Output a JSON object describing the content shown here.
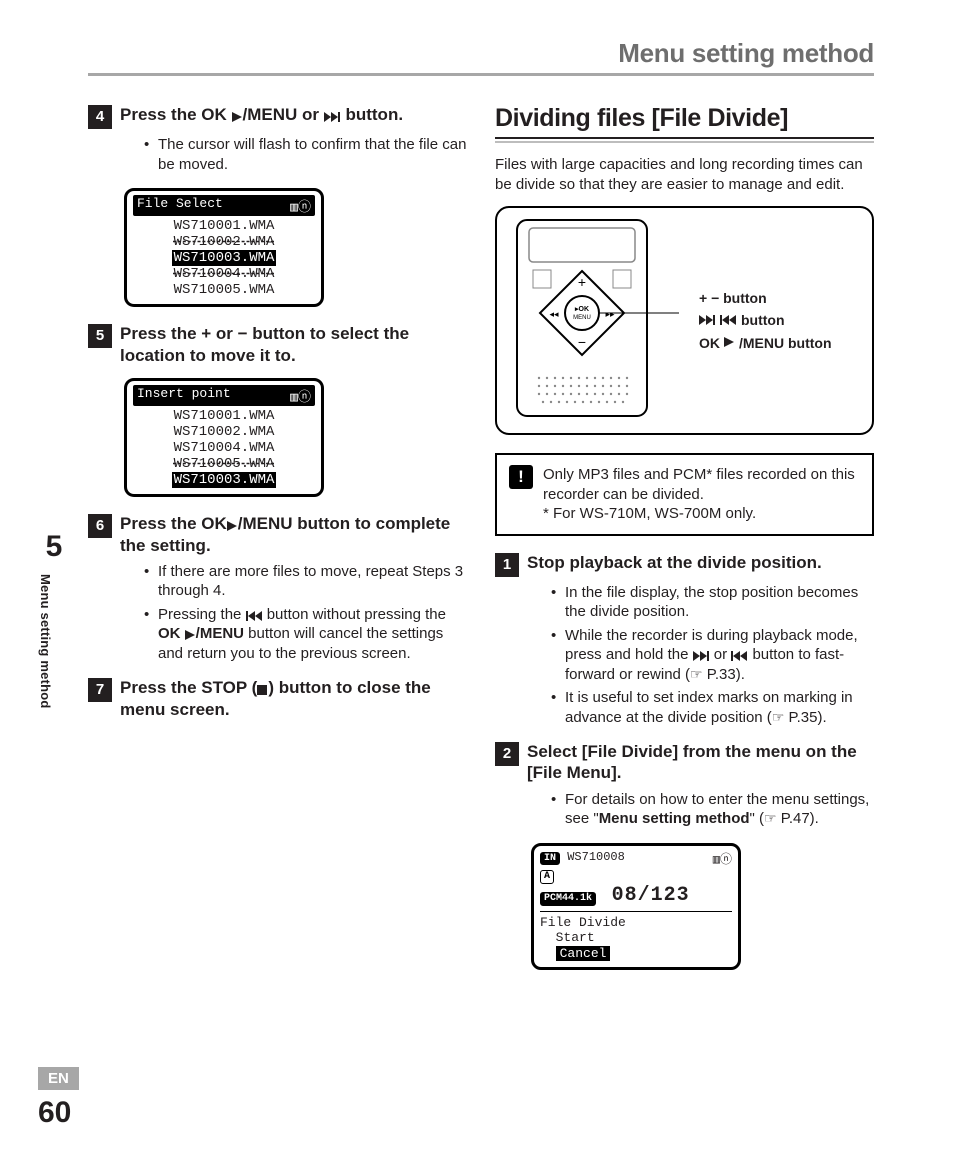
{
  "header": {
    "title": "Menu setting method"
  },
  "sidetab": {
    "chapter": "5",
    "label": "Menu setting method"
  },
  "footer": {
    "lang": "EN",
    "page": "60"
  },
  "left": {
    "step4": {
      "num": "4",
      "head_a": "Press the ",
      "head_ok": "OK",
      "head_menu": "/MENU",
      "head_or": " or ",
      "head_b": " button.",
      "bullet1": "The cursor will flash to confirm that the file can be moved."
    },
    "screen1": {
      "title": "File Select",
      "r1": "WS710001.WMA",
      "r2": "WS710002.WMA",
      "r3": "WS710003.WMA",
      "r4": "WS710004.WMA",
      "r5": "WS710005.WMA"
    },
    "step5": {
      "num": "5",
      "head": "Press the + or − button to select the location to move it to."
    },
    "screen2": {
      "title": "Insert point",
      "r1": "WS710001.WMA",
      "r2": "WS710002.WMA",
      "r3": "WS710004.WMA",
      "r4": "WS710005.WMA",
      "r5": "WS710003.WMA"
    },
    "step6": {
      "num": "6",
      "head_a": "Press the ",
      "head_ok": "OK",
      "head_menu": "/MENU",
      "head_b": " button to complete the setting.",
      "b1": "If there are more files to move, repeat Steps 3 through 4.",
      "b2a": "Pressing the ",
      "b2b": " button without pressing the ",
      "b2_ok": "OK ",
      "b2_menu": "/MENU",
      "b2c": " button will cancel the settings and return you to the previous screen."
    },
    "step7": {
      "num": "7",
      "head_a": "Press the ",
      "head_stop": "STOP",
      "head_paren_open": " (",
      "head_paren_close": ") button to close the menu screen."
    }
  },
  "right": {
    "title": "Dividing files [File Divide]",
    "intro": "Files with large capacities and long recording times can be divide so that they are easier to manage and edit.",
    "labels": {
      "plusminus": "+ − button",
      "ffrew": " button",
      "okmenu_a": "OK",
      "okmenu_b": "/MENU button"
    },
    "note": {
      "line1": "Only MP3 files and PCM* files recorded on this recorder can be divided.",
      "line2": "* For WS-710M, WS-700M only."
    },
    "step1": {
      "num": "1",
      "head": "Stop playback at the divide position.",
      "b1": "In the file display, the stop position becomes the divide position.",
      "b2a": "While the recorder is during playback mode, press and hold the ",
      "b2b": " or ",
      "b2c": " button to fast-forward or rewind (",
      "b2ref": " P.33).",
      "b3a": "It is useful to set index marks on marking in advance at the divide position (",
      "b3ref": " P.35)."
    },
    "step2": {
      "num": "2",
      "head_a": "Select [",
      "head_fd": "File Divide",
      "head_b": "] from the menu on the [",
      "head_fm": "File Menu",
      "head_c": "].",
      "b1a": "For details on how to enter the menu settings, see \"",
      "b1_bold": "Menu setting method",
      "b1b": "\" (",
      "b1ref": " P.47)."
    },
    "screen3": {
      "file": "WS710008",
      "fmt": "PCM44.1k",
      "counter": "08/123",
      "menu": "File Divide",
      "opt1": "Start",
      "opt2": "Cancel"
    }
  }
}
